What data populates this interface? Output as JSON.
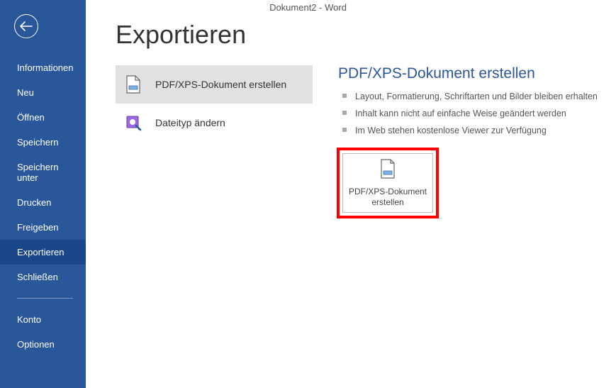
{
  "titlebar": "Dokument2 - Word",
  "sidebar": {
    "items": [
      {
        "label": "Informationen"
      },
      {
        "label": "Neu"
      },
      {
        "label": "Öffnen"
      },
      {
        "label": "Speichern"
      },
      {
        "label": "Speichern unter"
      },
      {
        "label": "Drucken"
      },
      {
        "label": "Freigeben"
      },
      {
        "label": "Exportieren"
      },
      {
        "label": "Schließen"
      }
    ],
    "footer": [
      {
        "label": "Konto"
      },
      {
        "label": "Optionen"
      }
    ]
  },
  "page_title": "Exportieren",
  "export_options": [
    {
      "label": "PDF/XPS-Dokument erstellen"
    },
    {
      "label": "Dateityp ändern"
    }
  ],
  "detail": {
    "title": "PDF/XPS-Dokument erstellen",
    "bullets": [
      "Layout, Formatierung, Schriftarten und Bilder bleiben erhalten",
      "Inhalt kann nicht auf einfache Weise geändert werden",
      "Im Web stehen kostenlose Viewer zur Verfügung"
    ],
    "button_label": "PDF/XPS-Dokument erstellen"
  }
}
